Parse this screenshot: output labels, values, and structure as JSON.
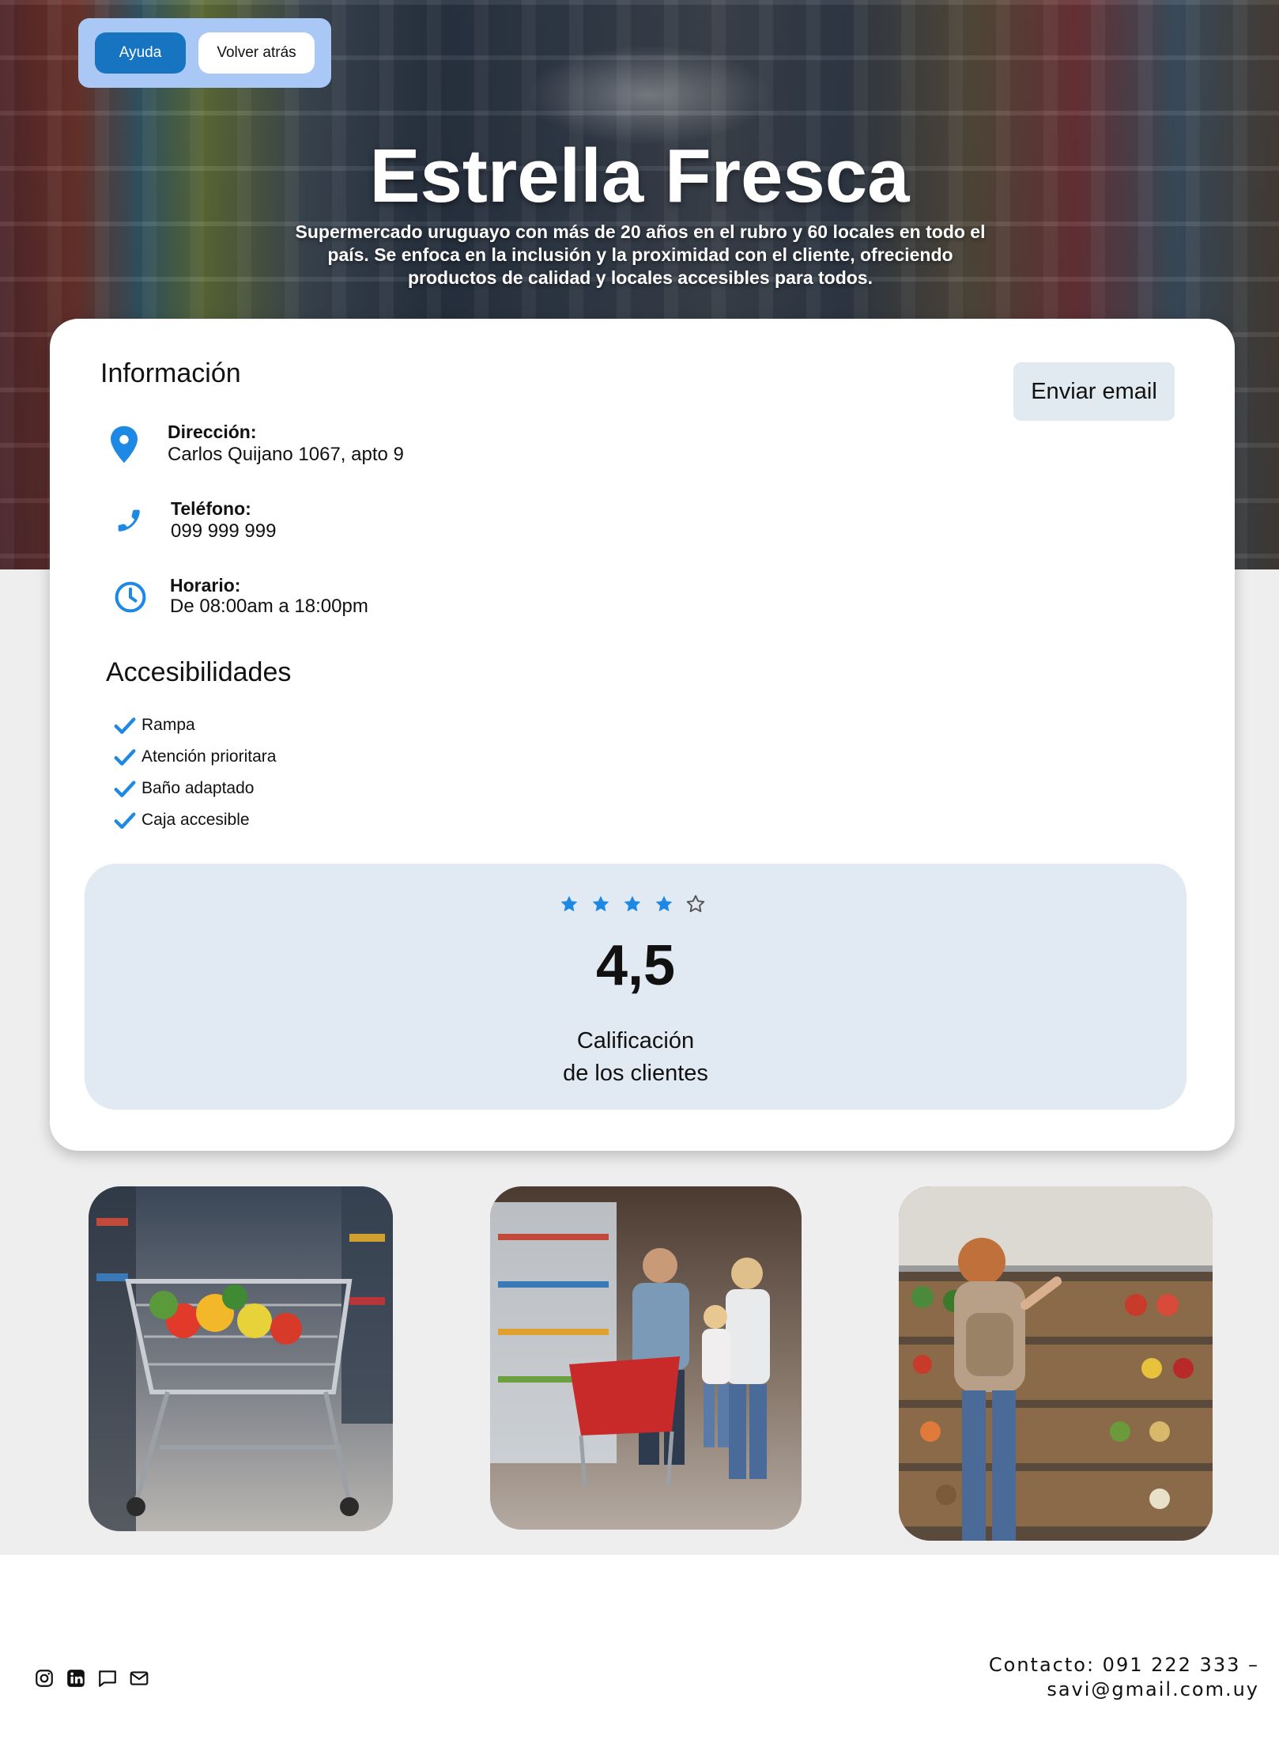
{
  "header": {
    "help_label": "Ayuda",
    "back_label": "Volver atrás"
  },
  "hero": {
    "title": "Estrella Fresca",
    "description": "Supermercado uruguayo con más de 20 años en el rubro y 60 locales en todo el país. Se enfoca en la inclusión y la proximidad con el cliente, ofreciendo productos de calidad y locales accesibles para todos."
  },
  "info": {
    "heading": "Información",
    "email_button": "Enviar email",
    "address": {
      "icon": "location-pin-icon",
      "label": "Dirección:",
      "value": "Carlos Quijano 1067, apto 9"
    },
    "phone": {
      "icon": "phone-icon",
      "label": "Teléfono:",
      "value": "099 999 999"
    },
    "hours": {
      "icon": "clock-icon",
      "label": "Horario:",
      "value": "De 08:00am a 18:00pm"
    }
  },
  "accessibility": {
    "heading": "Accesibilidades",
    "items": [
      "Rampa",
      "Atención prioritara",
      "Baño adaptado",
      "Caja accesible"
    ]
  },
  "rating": {
    "value": "4,5",
    "stars_filled": 4,
    "stars_total": 5,
    "label_line1": "Calificación",
    "label_line2": "de los clientes"
  },
  "photos": [
    {
      "icon": "shopping-cart-photo"
    },
    {
      "icon": "family-shopping-photo"
    },
    {
      "icon": "produce-aisle-photo"
    }
  ],
  "footer": {
    "social_icons": [
      "instagram-icon",
      "linkedin-icon",
      "chat-icon",
      "mail-icon"
    ],
    "contact_line1": "Contacto: 091 222 333  –",
    "contact_line2": "savi@gmail.com.uy"
  },
  "colors": {
    "accent": "#1674c0",
    "icon_blue": "#1e88e5",
    "panel": "#e1e9f2",
    "background_band": "#eeeeee"
  }
}
